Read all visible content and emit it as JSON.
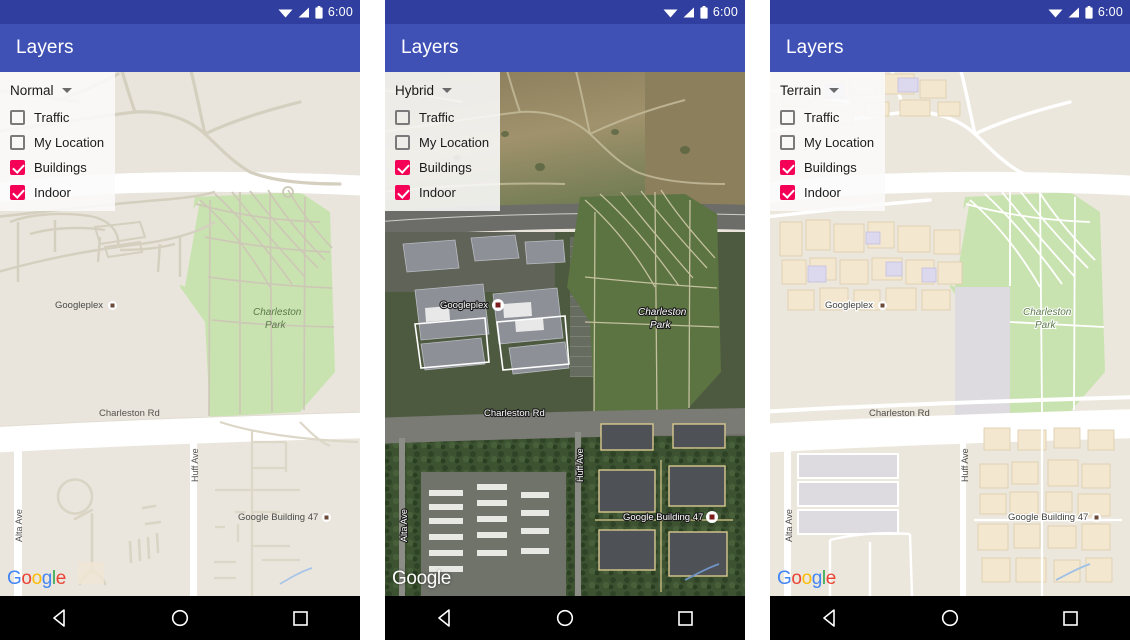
{
  "app": {
    "title": "Layers",
    "appbar_color": "#3f51b5",
    "statusbar_color": "#303f9f",
    "accent_color": "#f50057"
  },
  "statusbar": {
    "time": "6:00",
    "icons": [
      "wifi-icon",
      "signal-icon",
      "battery-icon"
    ]
  },
  "panels": [
    {
      "id": "normal",
      "map_type": "Normal",
      "checkboxes": [
        {
          "label": "Traffic",
          "checked": false
        },
        {
          "label": "My Location",
          "checked": false
        },
        {
          "label": "Buildings",
          "checked": true
        },
        {
          "label": "Indoor",
          "checked": true
        }
      ],
      "attribution": "Google",
      "attribution_style": "color"
    },
    {
      "id": "hybrid",
      "map_type": "Hybrid",
      "checkboxes": [
        {
          "label": "Traffic",
          "checked": false
        },
        {
          "label": "My Location",
          "checked": false
        },
        {
          "label": "Buildings",
          "checked": true
        },
        {
          "label": "Indoor",
          "checked": true
        }
      ],
      "attribution": "Google",
      "attribution_style": "white"
    },
    {
      "id": "terrain",
      "map_type": "Terrain",
      "checkboxes": [
        {
          "label": "Traffic",
          "checked": false
        },
        {
          "label": "My Location",
          "checked": false
        },
        {
          "label": "Buildings",
          "checked": true
        },
        {
          "label": "Indoor",
          "checked": true
        }
      ],
      "attribution": "Google",
      "attribution_style": "color"
    }
  ],
  "map_labels": {
    "googleplex": "Googleplex",
    "charleston_park_line1": "Charleston",
    "charleston_park_line2": "Park",
    "charleston_rd": "Charleston Rd",
    "alta_ave": "Alta Ave",
    "huff_ave": "Huff Ave",
    "google_building_47": "Google Building 47"
  },
  "navbar": {
    "back": "back-icon",
    "home": "home-icon",
    "recents": "recents-icon"
  },
  "map_colors": {
    "land": "#e9e5dc",
    "park_green": "#c9e3b0",
    "road_white": "#ffffff",
    "road_tan": "#d7d2c0",
    "building_tan": "#efe4cf",
    "building_purple": "#dcd8ee",
    "satellite_dark": "#3f4a33"
  }
}
